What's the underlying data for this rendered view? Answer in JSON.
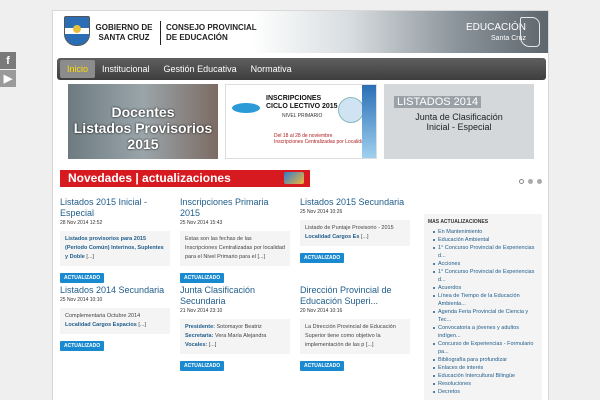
{
  "header": {
    "gob_line1": "GOBIERNO DE",
    "gob_line2": "SANTA CRUZ",
    "consejo_line1": "CONSEJO PROVINCIAL",
    "consejo_line2": "DE EDUCACIÓN",
    "edu_brand": "EDUCACIÓN",
    "edu_sub": "Santa Cruz"
  },
  "social": {
    "facebook": "f",
    "youtube": "▶"
  },
  "nav": {
    "items": [
      "Inicio",
      "Institucional",
      "Gestión Educativa",
      "Normativa"
    ]
  },
  "banners": [
    {
      "line1": "Docentes",
      "line2": "Listados Provisorios",
      "line3": "2015"
    },
    {
      "line1": "INSCRIPCIONES",
      "line2": "CICLO LECTIVO 2015",
      "line3": "NIVEL PRIMARIO",
      "line4": "Del 18 al 28 de noviembre",
      "line5": "Inscripciones Centralizadas por Localidad"
    },
    {
      "line1": "LISTADOS 2014",
      "line2": "Junta de Clasificación",
      "line3": "Inicial - Especial"
    }
  ],
  "strip": {
    "text": "Novedades | actualizaciones"
  },
  "button_label": "ACTUALIZADO",
  "articles": [
    {
      "title": "Listados 2015 Inicial - Especial",
      "date": "28 Nov 2014 12:52",
      "body_bold": "Listados provisorios para 2015 (Período Común) Interinos, Suplentes y Doble",
      "body_more": "[...]"
    },
    {
      "title": "Inscripciones Primaria 2015",
      "date": "25 Nov 2014 15:43",
      "body": "Estas son las fechas de las Inscripciones Centralizadas por localidad para el Nivel Primario para el",
      "body_more": "[...]"
    },
    {
      "title": "Listados 2015 Secundaria",
      "date": "25 Nov 2014 10:26",
      "body": "Listado de Puntaje Provisorio - 2015",
      "body_bold": "Localidad Cargos Es",
      "body_more": "[...]"
    },
    {
      "title": "Listados 2014 Secundaria",
      "date": "25 Nov 2014 10:10",
      "body": "Complementaria Octubre 2014",
      "body_bold": "Localidad Cargos Espacios",
      "body_more": "[...]"
    },
    {
      "title": "Junta Clasificación Secundaria",
      "date": "21 Nov 2014 23:10",
      "label1": "Presidente:",
      "text1": "Sotomayor Beatriz",
      "label2": "Secretaria:",
      "text2": "Vera María Alejandra",
      "label3": "Vocales:",
      "body_more": "[...]"
    },
    {
      "title": "Dirección Provincial de Educación Superi...",
      "date": "20 Nov 2014 10:16",
      "body": "La Dirección Provincial de Educación Superior tiene como objetivo la implementación de las p",
      "body_more": "[...]"
    }
  ],
  "sidebar": {
    "heading": "MAS ACTUALIZACIONES",
    "items": [
      "En Mantenimiento",
      "Educación Ambiental",
      "1° Concurso Provincial de Experiencias d...",
      "Acciones",
      "1° Concurso Provincial de Experiencias d...",
      "Acuerdos",
      "Línea de Tiempo de la Educación Ambienta...",
      "Agenda Feria Provincial de Ciencia y Tec...",
      "Convocatoria a jóvenes y adultos indígen...",
      "Concurso de Experiencias - Formulario pa...",
      "Bibliografía para profundizar",
      "Enlaces de interés",
      "Educación Intercultural Bilingüe",
      "Resoluciones",
      "Decretos"
    ]
  }
}
